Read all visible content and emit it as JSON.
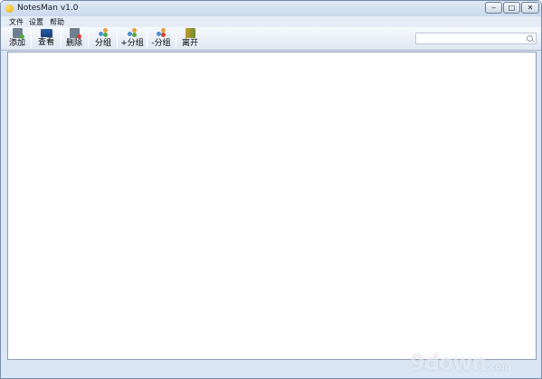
{
  "window": {
    "title": "NotesMan v1.0",
    "caption_buttons": {
      "minimize": "‒",
      "maximize": "□",
      "close": "✕"
    }
  },
  "menu": [
    {
      "label": "文件"
    },
    {
      "label": "设置"
    },
    {
      "label": "帮助"
    }
  ],
  "toolbar": {
    "add_label": "添加",
    "view_label": "查看",
    "delete_label": "删除",
    "group_label": "分组",
    "add_group_label": "+分组",
    "remove_group_label": "-分组",
    "leave_label": "离开"
  },
  "search": {
    "value": "",
    "placeholder": ""
  },
  "watermark": {
    "text": "9down",
    "suffix": ".com"
  },
  "colors": {
    "titlebar": "#c9d9ee",
    "window_frame": "#dbe6f4",
    "content_bg": "#ffffff"
  }
}
